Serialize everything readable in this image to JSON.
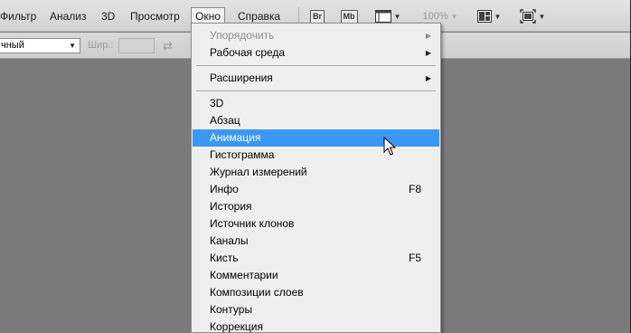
{
  "menubar": {
    "items": [
      "Фильтр",
      "Анализ",
      "3D",
      "Просмотр",
      "Окно",
      "Справка"
    ],
    "active": "Окно",
    "bridge_label": "Br",
    "minibridge_label": "Mb",
    "zoom_value": "100%",
    "icons": [
      "bridge-icon",
      "mini-bridge-icon",
      "view-extras-icon",
      "arrange-documents-icon",
      "screen-mode-icon"
    ]
  },
  "options": {
    "style_value": "чный",
    "width_label": "Шир.:",
    "width_value": ""
  },
  "window_menu": {
    "groups": [
      [
        {
          "label": "Упорядочить",
          "submenu": true,
          "disabled": true
        },
        {
          "label": "Рабочая среда",
          "submenu": true
        }
      ],
      [
        {
          "label": "Расширения",
          "submenu": true
        }
      ],
      [
        {
          "label": "3D"
        },
        {
          "label": "Абзац"
        },
        {
          "label": "Анимация",
          "highlighted": true
        },
        {
          "label": "Гистограмма"
        },
        {
          "label": "Журнал измерений"
        },
        {
          "label": "Инфо",
          "shortcut": "F8"
        },
        {
          "label": "История"
        },
        {
          "label": "Источник клонов"
        },
        {
          "label": "Каналы"
        },
        {
          "label": "Кисть",
          "shortcut": "F5"
        },
        {
          "label": "Комментарии"
        },
        {
          "label": "Композиции слоев"
        },
        {
          "label": "Контуры"
        },
        {
          "label": "Коррекция"
        }
      ]
    ]
  },
  "colors": {
    "highlight": "#3c97f3",
    "workspace": "#7a7a7a",
    "menu_bg": "#efefef"
  }
}
